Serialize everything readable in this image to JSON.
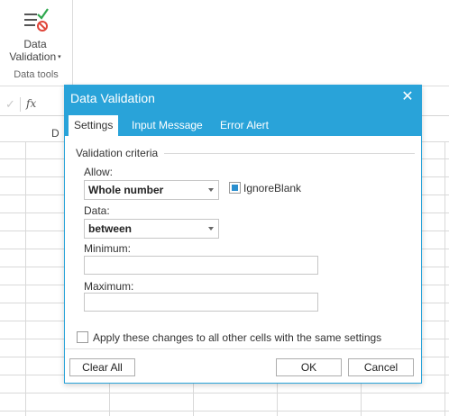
{
  "ribbon": {
    "data_validation_line1": "Data",
    "data_validation_line2": "Validation",
    "caret": "▾",
    "group_label": "Data tools"
  },
  "formula_bar": {
    "check_icon": "✓",
    "fx_label": "fx"
  },
  "sheet": {
    "visible_column_header": "D"
  },
  "dialog": {
    "title": "Data Validation",
    "close_glyph": "✕",
    "tabs": [
      {
        "label": "Settings",
        "active": true
      },
      {
        "label": "Input Message",
        "active": false
      },
      {
        "label": "Error Alert",
        "active": false
      }
    ],
    "validation_criteria_title": "Validation criteria",
    "allow_label": "Allow:",
    "allow_value": "Whole number",
    "ignore_blank_label": "IgnoreBlank",
    "ignore_blank_checked": true,
    "data_label": "Data:",
    "data_value": "between",
    "minimum_label": "Minimum:",
    "minimum_value": "",
    "maximum_label": "Maximum:",
    "maximum_value": "",
    "apply_all_label": "Apply these changes to all other cells with the same settings",
    "apply_all_checked": false,
    "buttons": {
      "clear_all": "Clear All",
      "ok": "OK",
      "cancel": "Cancel"
    }
  },
  "colors": {
    "accent": "#29a3d9",
    "checkbox_fill": "#2a8fcf",
    "icon_green": "#2fa84f",
    "icon_red": "#e0463a"
  }
}
